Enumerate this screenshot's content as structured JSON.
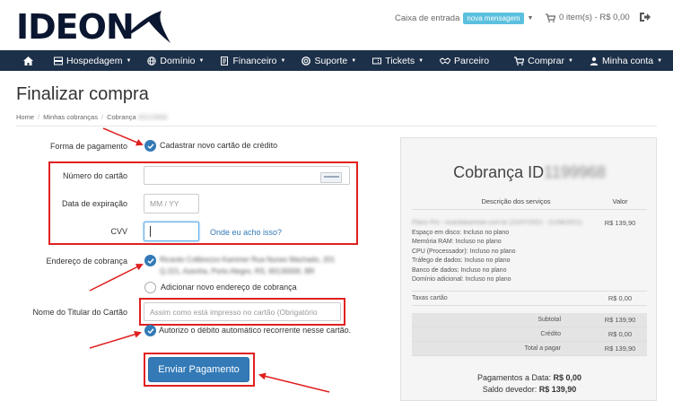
{
  "header": {
    "logo_text": "IDEON",
    "inbox_label": "Caixa de entrada",
    "inbox_badge": "nova mensagem",
    "cart_label": "0 item(s) - R$ 0,00"
  },
  "nav": {
    "items": [
      {
        "label": "Hospedagem",
        "icon": "server-icon"
      },
      {
        "label": "Domínio",
        "icon": "globe-icon"
      },
      {
        "label": "Financeiro",
        "icon": "invoice-icon"
      },
      {
        "label": "Suporte",
        "icon": "lifebuoy-icon"
      },
      {
        "label": "Tickets",
        "icon": "ticket-icon"
      },
      {
        "label": "Parceiro",
        "icon": "handshake-icon"
      },
      {
        "label": "Comprar",
        "icon": "cart-icon"
      },
      {
        "label": "Minha conta",
        "icon": "user-icon"
      }
    ]
  },
  "page": {
    "title": "Finalizar compra",
    "breadcrumb": [
      "Home",
      "Minhas cobranças",
      "Cobrança"
    ],
    "breadcrumb_hidden": "#0115668"
  },
  "form": {
    "payment_label": "Forma de pagamento",
    "payment_option": "Cadastrar novo cartão de crédito",
    "card_number_label": "Número do cartão",
    "expiry_label": "Data de expiração",
    "expiry_placeholder": "MM / YY",
    "cvv_label": "CVV",
    "cvv_help_link": "Onde eu acho isso?",
    "billing_label": "Endereço de cobrança",
    "billing_address_line1": "Ricardo Colibrezzo Kammer Rua Nunes Machado, 201",
    "billing_address_line2": "Q.221, Azenha, Porto Alegre, RS, 90130000, BR",
    "add_address_label": "Adicionar novo endereço de cobrança",
    "holder_label": "Nome do Titular do Cartão",
    "holder_placeholder": "Assim como está impresso no cartão (Obrigatório",
    "autodebit_label": "Autorizo o débito automático recorrente nesse cartão.",
    "submit_label": "Enviar Pagamento"
  },
  "summary": {
    "title": "Cobrança ID",
    "title_hidden": "1199968",
    "col_desc": "Descrição dos serviços",
    "col_value": "Valor",
    "service_line_hidden": "Plano Pro - ricardokammer.com.br (22/07/2021 - 21/08/2021)",
    "service_value": "R$ 139,90",
    "service_details": [
      "Espaço em disco: Incluso no plano",
      "Memória RAM: Incluso no plano",
      "CPU (Processador): Incluso no plano",
      "Tráfego de dados: Incluso no plano",
      "Banco de dados: Incluso no plano",
      "Domínio adicional: Incluso no plano"
    ],
    "taxes_label": "Taxas cartão",
    "taxes_value": "R$ 0,00",
    "subtotal_label": "Subtotal",
    "subtotal_value": "R$ 139,90",
    "credit_label": "Crédito",
    "credit_value": "R$ 0,00",
    "total_label": "Total a pagar",
    "total_value": "R$ 139,90",
    "paid_label": "Pagamentos a Data:",
    "paid_value": "R$ 0,00",
    "balance_label": "Saldo devedor:",
    "balance_value": "R$ 139,90"
  },
  "colors": {
    "nav_bg": "#1d3049",
    "primary": "#337ab7",
    "annotation_red": "#e02020",
    "badge": "#5bc0de"
  }
}
